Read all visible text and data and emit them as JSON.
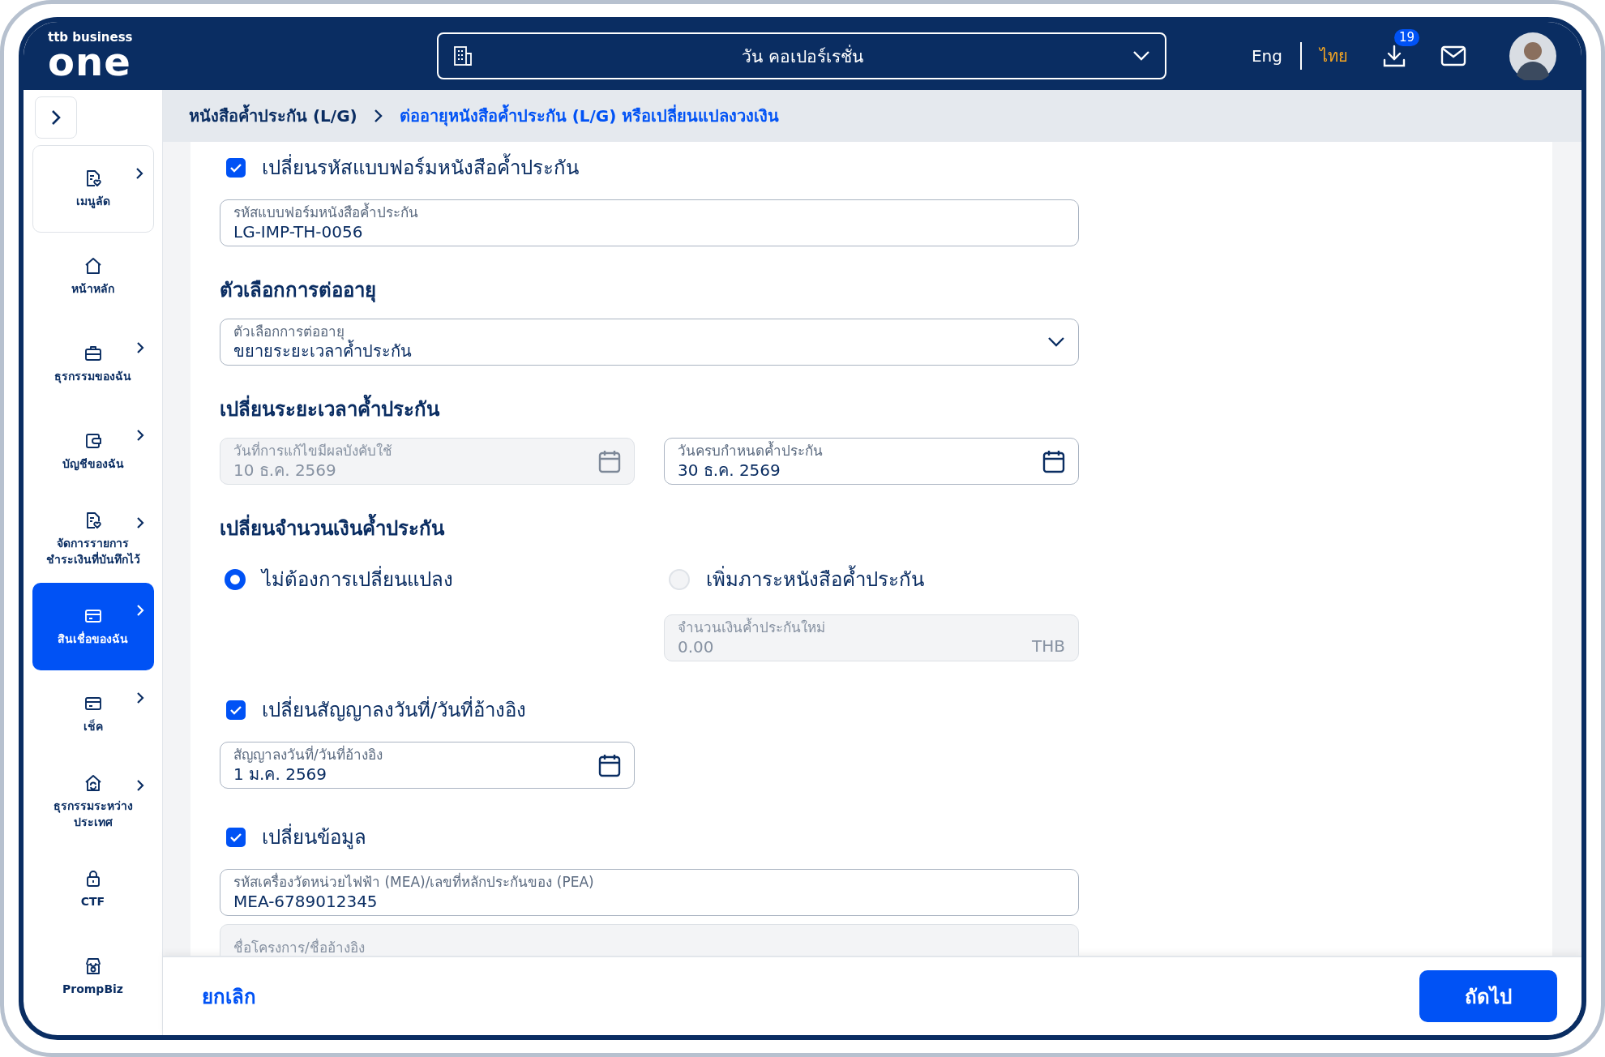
{
  "header": {
    "logo_top": "ttb business",
    "logo_main": "one",
    "company": "วัน คอเปอร์เรชั่น",
    "languages": [
      {
        "label": "Eng",
        "selected": false
      },
      {
        "label": "ไทย",
        "selected": true
      }
    ],
    "download_badge": "19"
  },
  "sidebar": {
    "items": [
      {
        "label": "เมนูลัด",
        "has_submenu": true,
        "selected": false,
        "kind": "shortcut"
      },
      {
        "label": "หน้าหลัก",
        "has_submenu": false,
        "selected": false,
        "kind": "home"
      },
      {
        "label": "ธุรกรรมของฉัน",
        "has_submenu": true,
        "selected": false,
        "kind": "briefcase"
      },
      {
        "label": "บัญชีของฉัน",
        "has_submenu": true,
        "selected": false,
        "kind": "wallet"
      },
      {
        "label": "จัดการรายการชำระเงินที่บันทึกไว้",
        "has_submenu": true,
        "selected": false,
        "kind": "shortcut"
      },
      {
        "label": "สินเชื่อของฉัน",
        "has_submenu": true,
        "selected": true,
        "kind": "card"
      },
      {
        "label": "เช็ค",
        "has_submenu": true,
        "selected": false,
        "kind": "card"
      },
      {
        "label": "ธุรกรรมระหว่างประเทศ",
        "has_submenu": true,
        "selected": false,
        "kind": "globe"
      },
      {
        "label": "CTF",
        "has_submenu": false,
        "selected": false,
        "kind": "lock"
      },
      {
        "label": "PrompBiz",
        "has_submenu": false,
        "selected": false,
        "kind": "shop"
      }
    ]
  },
  "breadcrumb": [
    {
      "label": "หนังสือค้ำประกัน (L/G)",
      "selected": false
    },
    {
      "label": "ต่ออายุหนังสือค้ำประกัน (L/G) หรือเปลี่ยนแปลงวงเงิน",
      "selected": true
    }
  ],
  "form": {
    "form_code": {
      "checkbox": {
        "label": "เปลี่ยนรหัสแบบฟอร์มหนังสือค้ำประกัน",
        "checked": true
      },
      "field": {
        "label": "รหัสแบบฟอร์มหนังสือค้ำประกัน",
        "value": "LG-IMP-TH-0056"
      }
    },
    "renewal": {
      "heading": "ตัวเลือกการต่ออายุ",
      "select": {
        "label": "ตัวเลือกการต่ออายุ",
        "value": "ขยายระยะเวลาค้ำประกัน"
      }
    },
    "period": {
      "heading": "เปลี่ยนระยะเวลาค้ำประกัน",
      "dates": [
        {
          "label": "วันที่การแก้ไขมีผลบังคับใช้",
          "value": "10 ธ.ค. 2569",
          "disabled": true
        },
        {
          "label": "วันครบกำหนดค้ำประกัน",
          "value": "30 ธ.ค. 2569",
          "disabled": false
        }
      ]
    },
    "amount": {
      "heading": "เปลี่ยนจำนวนเงินค้ำประกัน",
      "options": [
        {
          "label": "ไม่ต้องการเปลี่ยนแปลง",
          "selected": true
        },
        {
          "label": "เพิ่มภาระหนังสือค้ำประกัน",
          "selected": false
        }
      ],
      "new_amount": {
        "label": "จำนวนเงินค้ำประกันใหม่",
        "value": "0.00",
        "unit": "THB",
        "disabled": true
      }
    },
    "contract_date": {
      "checkbox": {
        "label": "เปลี่ยนสัญญาลงวันที่/วันที่อ้างอิง",
        "checked": true
      },
      "field": {
        "label": "สัญญาลงวันที่/วันที่อ้างอิง",
        "value": "1 ม.ค. 2569",
        "disabled": false
      }
    },
    "info": {
      "checkbox": {
        "label": "เปลี่ยนข้อมูล",
        "checked": true
      },
      "fields": [
        {
          "label": "รหัสเครื่องวัดหน่วยไฟฟ้า (MEA)/เลขที่หลักประกันของ (PEA)",
          "value": "MEA-6789012345",
          "disabled": false
        },
        {
          "label": "ชื่อโครงการ/ชื่ออ้างอิง",
          "disabled": true
        }
      ]
    }
  },
  "footer": {
    "cancel": "ยกเลิก",
    "next": "ถัดไป"
  }
}
